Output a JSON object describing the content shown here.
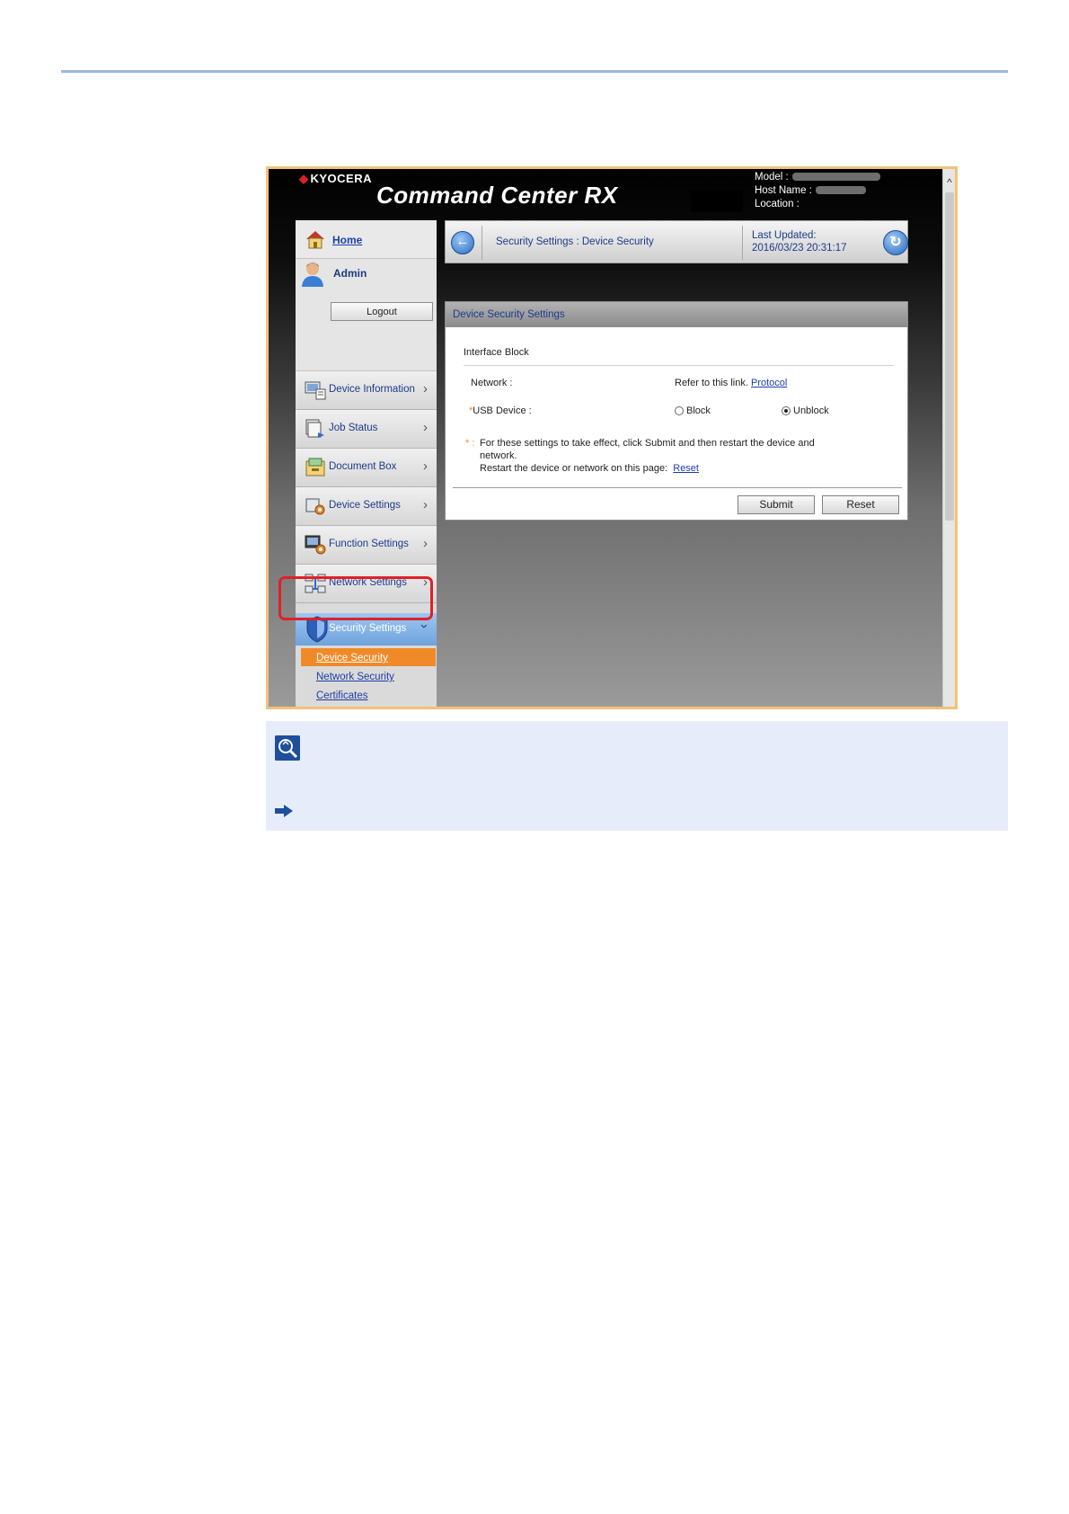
{
  "header": {
    "brand": "KYOCERA",
    "product_title": "Command Center RX",
    "model_label": "Model :",
    "host_label": "Host Name :",
    "location_label": "Location :"
  },
  "sidebar": {
    "home_label": "Home",
    "user_label": "Admin",
    "logout_label": "Logout",
    "items": [
      {
        "label": "Device Information",
        "icon": "device-information-icon"
      },
      {
        "label": "Job Status",
        "icon": "job-status-icon"
      },
      {
        "label": "Document Box",
        "icon": "document-box-icon"
      },
      {
        "label": "Device Settings",
        "icon": "device-settings-icon"
      },
      {
        "label": "Function Settings",
        "icon": "function-settings-icon"
      },
      {
        "label": "Network Settings",
        "icon": "network-settings-icon"
      }
    ],
    "active_item": {
      "label": "Security Settings",
      "icon": "shield-icon"
    },
    "sub_items": [
      "Device Security",
      "Network Security",
      "Certificates"
    ]
  },
  "breadcrumb": {
    "path": "Security Settings : Device Security",
    "last_updated_label": "Last Updated:",
    "last_updated_value": "2016/03/23 20:31:17"
  },
  "panel": {
    "title": "Device Security Settings",
    "section_title": "Interface Block",
    "network_label": "Network :",
    "network_ref_text": "Refer to this link.",
    "network_link": "Protocol",
    "usb_asterisk": "*",
    "usb_label": "USB Device :",
    "usb_options": [
      "Block",
      "Unblock"
    ],
    "usb_selected": "Unblock",
    "note_marker": "* :",
    "note_line1": "For these settings to take effect, click Submit and then restart the device and",
    "note_line2": "network.",
    "note_line3": "Restart the device or network on this page:",
    "note_link": "Reset",
    "submit_label": "Submit",
    "reset_label": "Reset"
  },
  "colors": {
    "accent_orange": "#f08a28",
    "highlight_red": "#e0202a",
    "link_blue": "#1b3ea8",
    "note_bg": "#e6ecfa"
  }
}
